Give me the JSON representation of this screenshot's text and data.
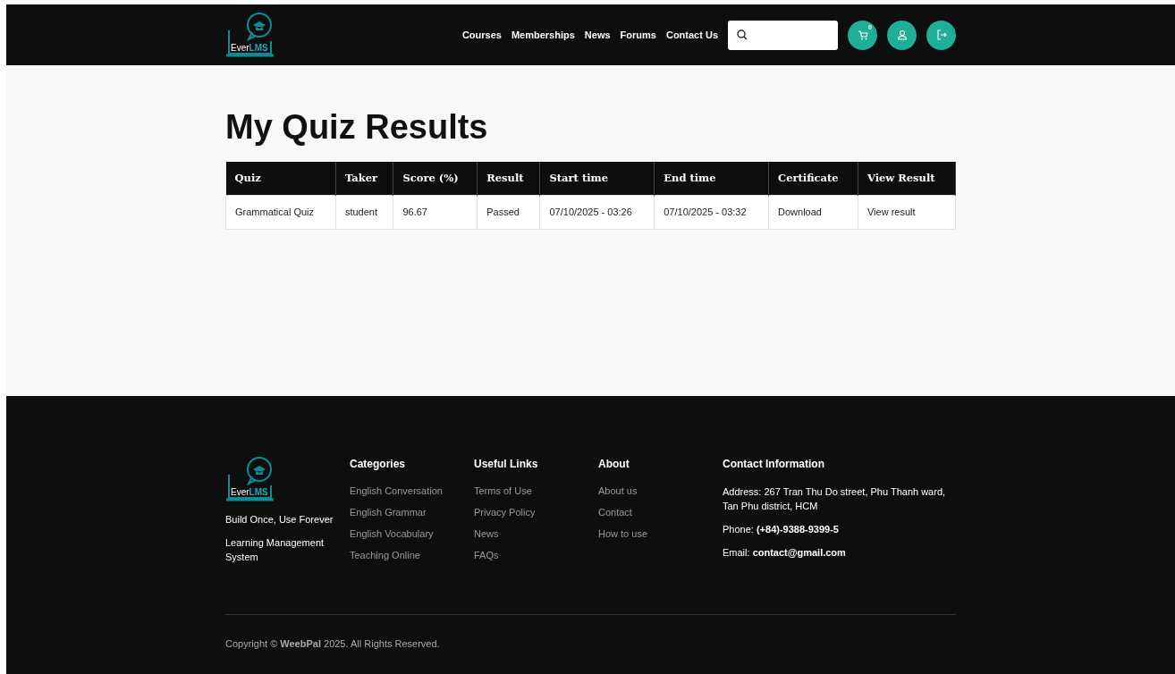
{
  "header": {
    "logo": {
      "part_1": "Ever",
      "part_2": "LMS"
    },
    "nav": [
      "Courses",
      "Memberships",
      "News",
      "Forums",
      "Contact Us"
    ],
    "cart_count": "0"
  },
  "page_title": "My Quiz Results",
  "table": {
    "columns": [
      "Quiz",
      "Taker",
      "Score (%)",
      "Result",
      "Start time",
      "End time",
      "Certificate",
      "View Result"
    ],
    "rows": [
      [
        "Grammatical Quiz",
        "student",
        "96.67",
        "Passed",
        "07/10/2025 - 03:26",
        "07/10/2025 - 03:32",
        "Download",
        "View result"
      ]
    ]
  },
  "footer": {
    "logo": {
      "part_1": "Ever",
      "part_2": "LMS"
    },
    "taglines": [
      "Build Once, Use Forever",
      "Learning Management System"
    ],
    "columns": [
      {
        "title": "Categories",
        "links": [
          "English Conversation",
          "English Grammar",
          "English Vocabulary",
          "Teaching Online"
        ]
      },
      {
        "title": "Useful Links",
        "links": [
          "Terms of Use",
          "Privacy Policy",
          "News",
          "FAQs"
        ]
      },
      {
        "title": "About",
        "links": [
          "About us",
          "Contact",
          "How to use"
        ]
      }
    ],
    "contact": {
      "title": "Contact Information",
      "lines": [
        "Address: 267 Tran Thu Do street, Phu Thanh ward, Tan Phu district, HCM",
        "Phone: **(+84)-9388-9399-5**",
        "Email: **contact@gmail.com**"
      ]
    },
    "copyright": "Copyright © **WeebPal**  2025. All Rights Reserved."
  }
}
